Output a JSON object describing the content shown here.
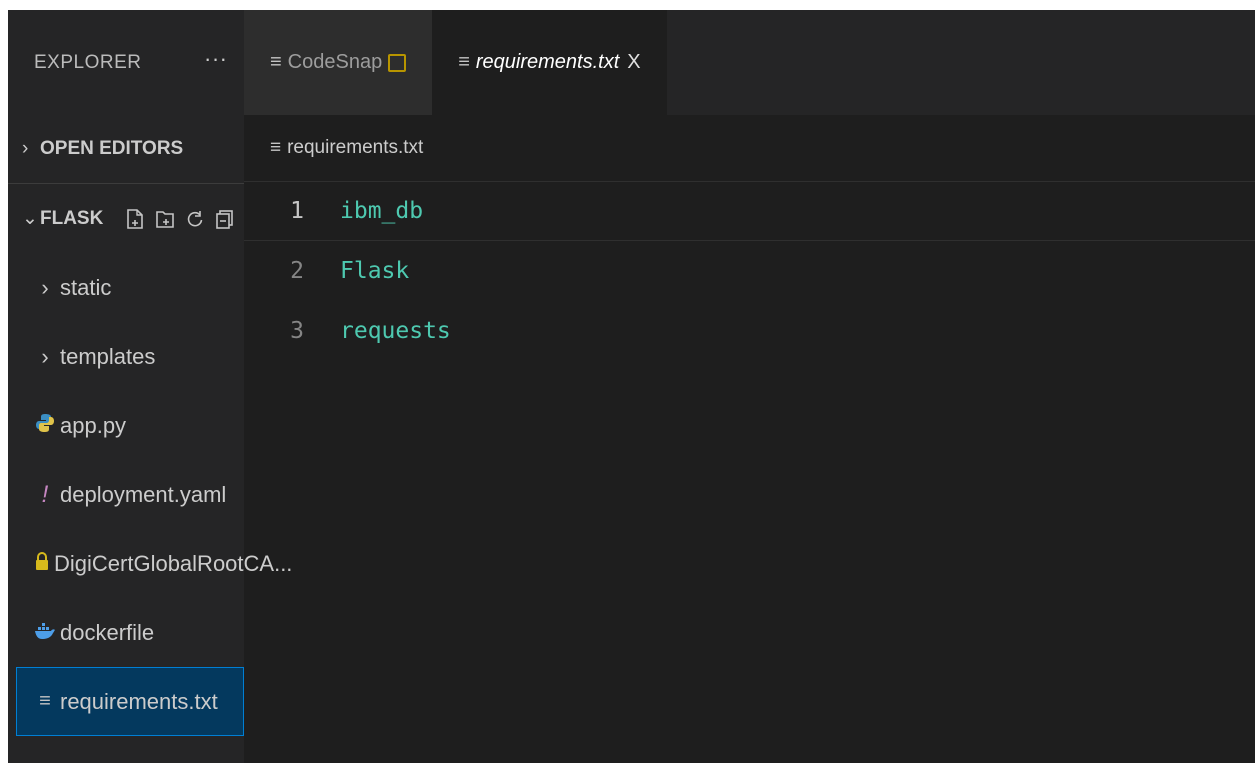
{
  "sidebar": {
    "title": "EXPLORER",
    "more": "···",
    "open_editors": "OPEN EDITORS",
    "folder": "FLASK",
    "items": [
      {
        "label": "static",
        "icon": "chevron-right-icon"
      },
      {
        "label": "templates",
        "icon": "chevron-right-icon"
      },
      {
        "label": "app.py",
        "icon": "python-icon"
      },
      {
        "label": "deployment.yaml",
        "icon": "yaml-exclamation-icon"
      },
      {
        "label": "DigiCertGlobalRootCA...",
        "icon": "lock-icon"
      },
      {
        "label": "dockerfile",
        "icon": "docker-icon"
      },
      {
        "label": "requirements.txt",
        "icon": "text-file-icon"
      }
    ]
  },
  "tabs": [
    {
      "label": "CodeSnap",
      "active": false
    },
    {
      "label": "requirements.txt",
      "active": true,
      "close": "X"
    }
  ],
  "breadcrumb": "requirements.txt",
  "editor": {
    "lines": [
      {
        "number": "1",
        "text": "ibm_db"
      },
      {
        "number": "2",
        "text": "Flask"
      },
      {
        "number": "3",
        "text": "requests"
      }
    ]
  },
  "colors": {
    "code": "#4ec9b0",
    "selection": "#04395e",
    "python": "#3b8ec2",
    "yaml": "#c586c0",
    "lock": "#d7ba1c",
    "docker": "#4d9ee8"
  }
}
